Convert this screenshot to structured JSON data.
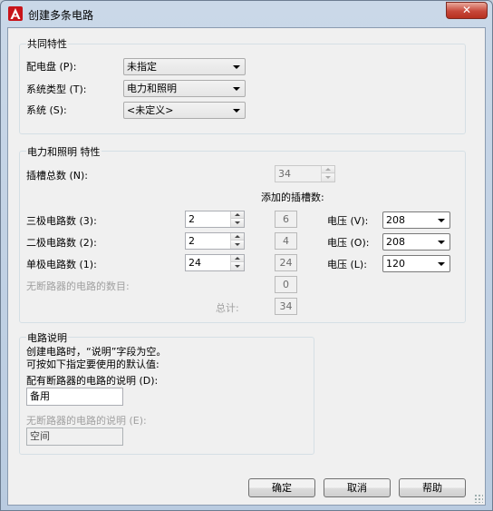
{
  "window": {
    "title": "创建多条电路",
    "close_glyph": "✕",
    "icon": "autocad-logo-icon"
  },
  "common": {
    "title": "共同特性",
    "panel_label": "配电盘 (P):",
    "panel_value": "未指定",
    "systype_label": "系统类型 (T):",
    "systype_value": "电力和照明",
    "system_label": "系统 (S):",
    "system_value": "<未定义>"
  },
  "power": {
    "title": "电力和照明 特性",
    "total_slots_label": "插槽总数 (N):",
    "total_slots_value": "34",
    "added_slots_header": "添加的插槽数:",
    "rows": [
      {
        "label": "三极电路数 (3):",
        "count": "2",
        "slots": "6",
        "voltage_label": "电压 (V):",
        "voltage": "208"
      },
      {
        "label": "二极电路数 (2):",
        "count": "2",
        "slots": "4",
        "voltage_label": "电压 (O):",
        "voltage": "208"
      },
      {
        "label": "单极电路数 (1):",
        "count": "24",
        "slots": "24",
        "voltage_label": "电压 (L):",
        "voltage": "120"
      }
    ],
    "no_breaker_label": "无断路器的电路的数目:",
    "no_breaker_slots": "0",
    "total_label": "总计:",
    "total_value": "34"
  },
  "description": {
    "title": "电路说明",
    "note_line1": "创建电路时，“说明”字段为空。",
    "note_line2": "可按如下指定要使用的默认值:",
    "with_breaker_label": "配有断路器的电路的说明 (D):",
    "with_breaker_value": "备用",
    "without_breaker_label": "无断路器的电路的说明 (E):",
    "without_breaker_value": "空间"
  },
  "buttons": {
    "ok": "确定",
    "cancel": "取消",
    "help": "帮助"
  }
}
